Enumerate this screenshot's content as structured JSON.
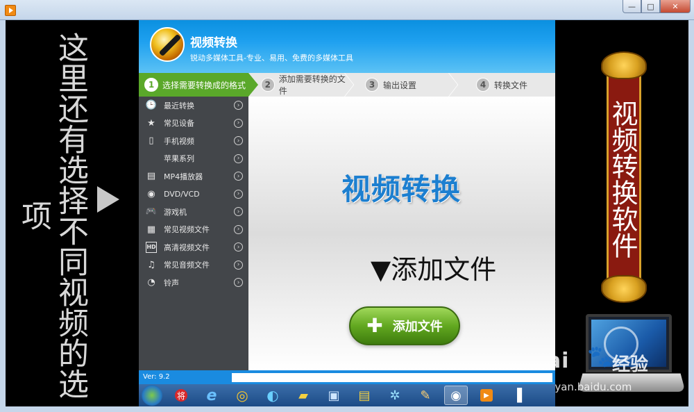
{
  "left_caption": "这里还有选择不同视频的选项",
  "banner_text": "视频转换软件",
  "watermark": {
    "logo": "Bai",
    "paw": "🐾",
    "cn": "经验",
    "url": "jingyan.baidu.com"
  },
  "window": {
    "minimize": "—",
    "maximize": "□",
    "close": "✕"
  },
  "app": {
    "title": "视频转换",
    "subtitle": "锐动多媒体工具-专业、易用、免费的多媒体工具",
    "steps": [
      {
        "num": "1",
        "label": "选择需要转换成的格式"
      },
      {
        "num": "2",
        "label": "添加需要转换的文件"
      },
      {
        "num": "3",
        "label": "输出设置"
      },
      {
        "num": "4",
        "label": "转换文件"
      }
    ],
    "menu": [
      {
        "icon": "🕒",
        "label": "最近转换"
      },
      {
        "icon": "★",
        "label": "常见设备"
      },
      {
        "icon": "▯",
        "label": "手机视频"
      },
      {
        "icon": "",
        "label": "苹果系列"
      },
      {
        "icon": "▤",
        "label": "MP4播放器"
      },
      {
        "icon": "◉",
        "label": "DVD/VCD"
      },
      {
        "icon": "🎮",
        "label": "游戏机"
      },
      {
        "icon": "▦",
        "label": "常见视频文件"
      },
      {
        "icon": "HD",
        "label": "高清视频文件"
      },
      {
        "icon": "♫",
        "label": "常见音频文件"
      },
      {
        "icon": "◔",
        "label": "铃声"
      }
    ],
    "chevron": "›",
    "big_title": "视频转换",
    "hint": "▼添加文件",
    "add_button": "添加文件",
    "plus": "✚",
    "version": "Ver: 9.2"
  },
  "taskbar": {
    "items": [
      "",
      "将",
      "e",
      "◎",
      "◐",
      "▰",
      "▣",
      "▤",
      "✲",
      "✎",
      "◉",
      "▶",
      "▐"
    ]
  },
  "colors": {
    "header_blue": "#1ea0ef",
    "step_active": "#5aa82a",
    "sidebar": "#43464a",
    "title_blue": "#1c7fd0"
  }
}
